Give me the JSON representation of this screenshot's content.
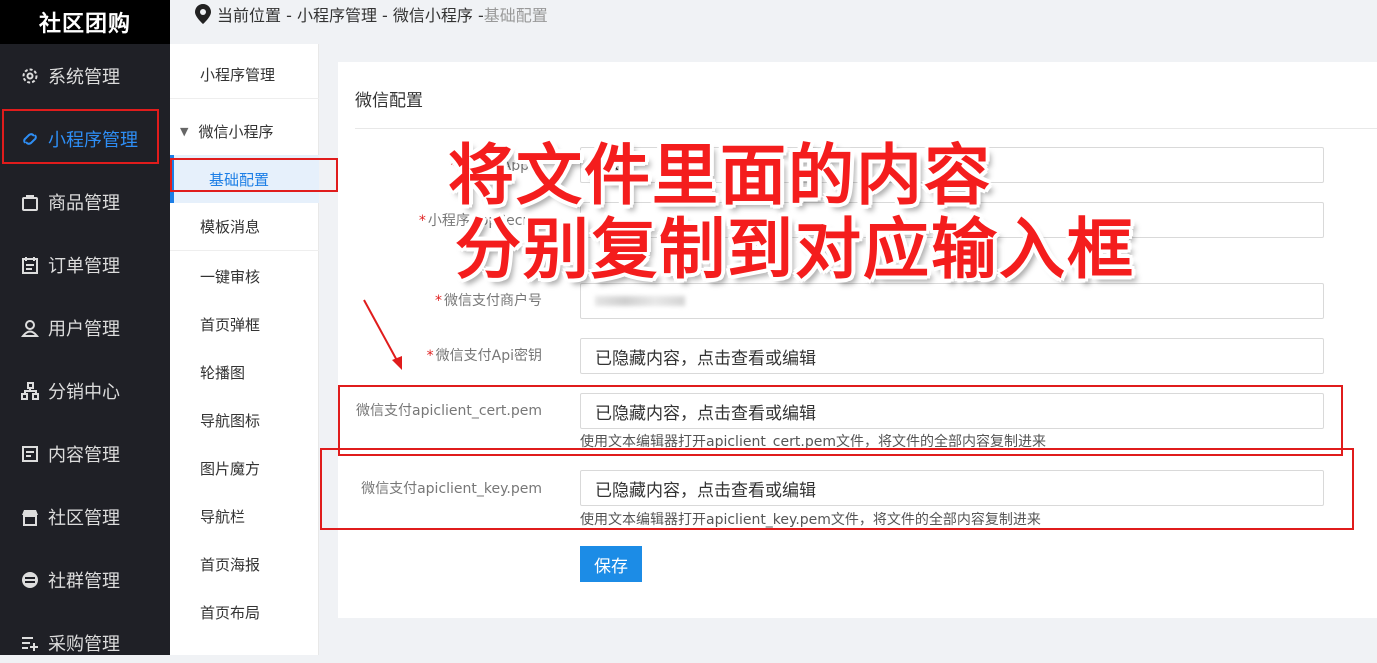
{
  "app": {
    "logo": "社区团购"
  },
  "breadcrumb": {
    "prefix": "当前位置 - 小程序管理 - 微信小程序 - ",
    "current": "基础配置"
  },
  "nav": [
    {
      "label": "系统管理",
      "icon": "gear-icon"
    },
    {
      "label": "小程序管理",
      "icon": "link-icon"
    },
    {
      "label": "商品管理",
      "icon": "bag-icon"
    },
    {
      "label": "订单管理",
      "icon": "calendar-icon"
    },
    {
      "label": "用户管理",
      "icon": "user-icon"
    },
    {
      "label": "分销中心",
      "icon": "org-icon"
    },
    {
      "label": "内容管理",
      "icon": "doc-icon"
    },
    {
      "label": "社区管理",
      "icon": "store-icon"
    },
    {
      "label": "社群管理",
      "icon": "minus-circle-icon"
    },
    {
      "label": "采购管理",
      "icon": "list-add-icon"
    }
  ],
  "subnav": {
    "top": "小程序管理",
    "group": "微信小程序",
    "items": [
      "基础配置",
      "模板消息",
      "一键审核",
      "首页弹框",
      "轮播图",
      "导航图标",
      "图片魔方",
      "导航栏",
      "首页海报",
      "首页布局"
    ]
  },
  "card": {
    "title": "微信配置"
  },
  "form": {
    "appid_label": "小程序AppId",
    "appid_value": "wx",
    "secret_label": "小程序AppSecret",
    "mchid_label": "微信支付商户号",
    "apikey_label": "微信支付Api密钥",
    "apikey_value": "已隐藏内容，点击查看或编辑",
    "cert_label": "微信支付apiclient_cert.pem",
    "cert_value": "已隐藏内容，点击查看或编辑",
    "cert_help": "使用文本编辑器打开apiclient_cert.pem文件，将文件的全部内容复制进来",
    "key_label": "微信支付apiclient_key.pem",
    "key_value": "已隐藏内容，点击查看或编辑",
    "key_help": "使用文本编辑器打开apiclient_key.pem文件，将文件的全部内容复制进来",
    "save": "保存"
  },
  "annotation": {
    "line1": "将文件里面的内容",
    "line2": "分别复制到对应输入框"
  },
  "colors": {
    "accent": "#1c8ce6",
    "annotation": "#f41d1d",
    "sidebar": "#1f2026"
  }
}
